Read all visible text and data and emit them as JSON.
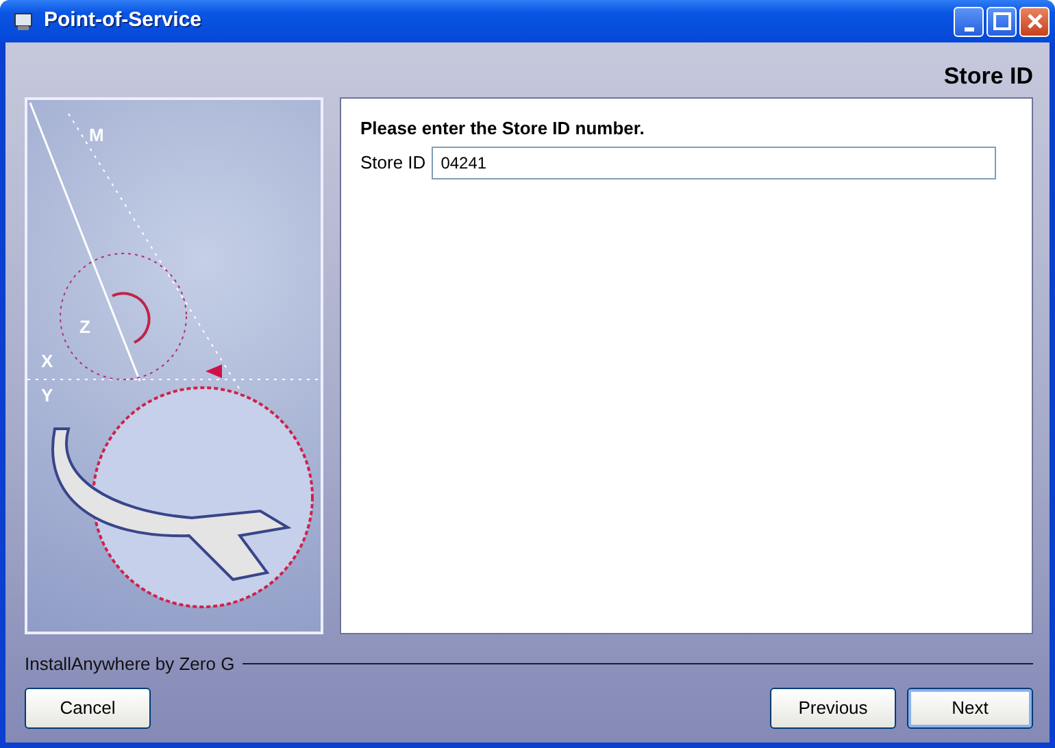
{
  "window": {
    "title": "Point-of-Service"
  },
  "step_title": "Store ID",
  "illustration": {
    "labels": [
      "M",
      "Z",
      "X",
      "Y"
    ]
  },
  "prompt": "Please enter  the Store ID number.",
  "field": {
    "label": "Store ID",
    "value": "04241"
  },
  "footer": {
    "vendor": "InstallAnywhere by Zero G"
  },
  "buttons": [
    {
      "label": "Cancel",
      "focused": false
    },
    {
      "label": "Previous",
      "focused": false
    },
    {
      "label": "Next",
      "focused": true
    }
  ]
}
